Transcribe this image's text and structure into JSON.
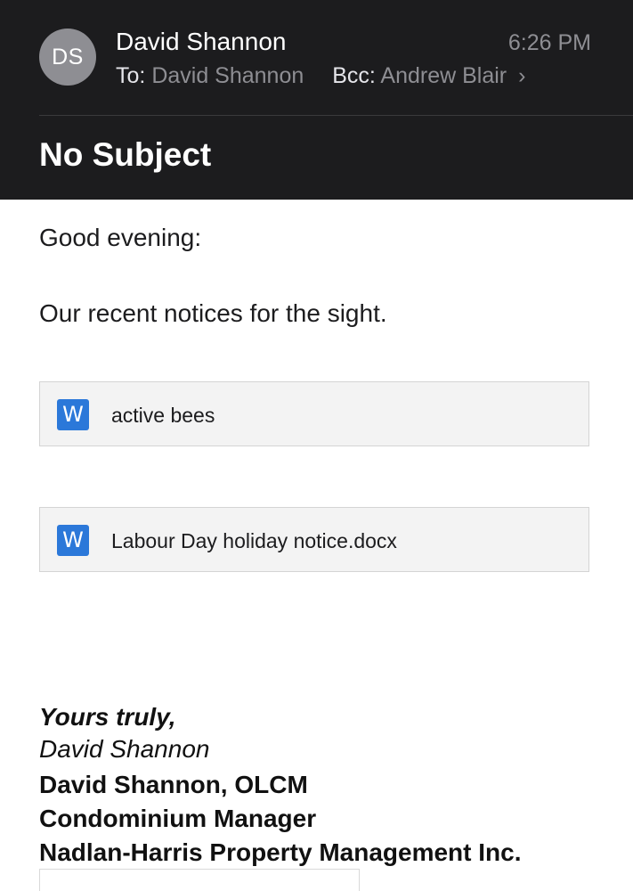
{
  "header": {
    "avatar_initials": "DS",
    "sender_name": "David Shannon",
    "time": "6:26 PM",
    "to_label": "To:",
    "to_value": "David Shannon",
    "bcc_label": "Bcc:",
    "bcc_value": "Andrew Blair",
    "chevron": "›",
    "subject": "No Subject"
  },
  "body": {
    "greeting": "Good evening:",
    "message": "Our recent notices for the sight."
  },
  "attachments": [
    {
      "icon": "word-document-icon",
      "icon_letter": "W",
      "name": "active bees"
    },
    {
      "icon": "word-document-icon",
      "icon_letter": "W",
      "name": "Labour Day holiday notice.docx"
    }
  ],
  "signature": {
    "closing": "Yours truly,",
    "name_italic": "David Shannon",
    "line1": "David Shannon, OLCM",
    "line2": "Condominium Manager",
    "line3": "Nadlan-Harris Property Management Inc."
  },
  "colors": {
    "header_bg": "#1c1c1e",
    "avatar_bg": "#8e8e93",
    "secondary_text": "#8e8e93",
    "word_blue": "#2b78d9",
    "attachment_bg": "#f3f3f3"
  }
}
